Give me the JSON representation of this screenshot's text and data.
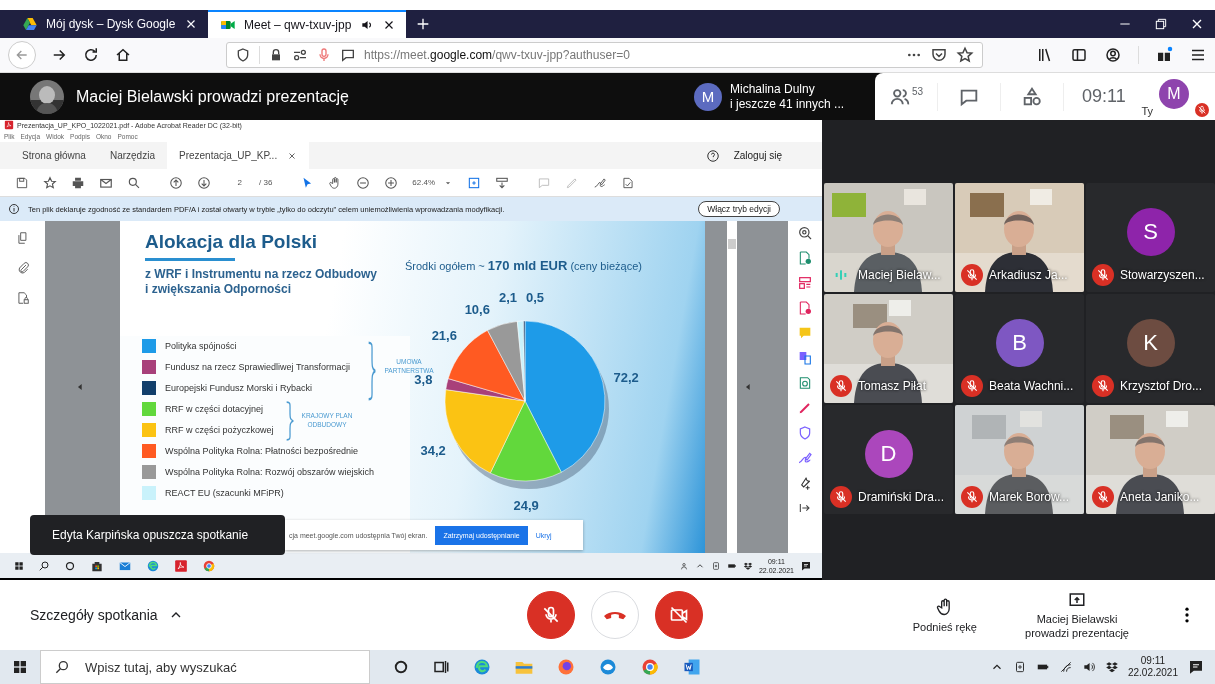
{
  "browser": {
    "tabs": [
      {
        "title": "Mój dysk – Dysk Google",
        "selected": false,
        "audio": false
      },
      {
        "title": "Meet – qwv-txuv-jpp",
        "selected": true,
        "audio": true
      }
    ],
    "url": "https://meet.**google.com**/qwv-txuv-jpp?authuser=0"
  },
  "meet_header": {
    "presenter": "Maciej Bielawski prowadzi prezentację",
    "speaker": {
      "initial": "M",
      "name": "Michalina Dulny",
      "others": "i jeszcze 41 innych ..."
    },
    "participants_count": "53",
    "time": "09:11",
    "self_label": "Ty",
    "self_initial": "M",
    "self_muted": true
  },
  "shared_screen": {
    "acrobat": {
      "title": "Prezentacja_UP_KPO_1022021.pdf - Adobe Acrobat Reader DC (32-bit)",
      "menu": [
        "Plik",
        "Edycja",
        "Widok",
        "Podpis",
        "Okno",
        "Pomoc"
      ],
      "tabs": [
        {
          "label": "Strona główna",
          "selected": false
        },
        {
          "label": "Narzędzia",
          "selected": false
        },
        {
          "label": "Prezentacja_UP_KP...",
          "selected": true
        }
      ],
      "sign_in": "Zaloguj się",
      "page": "2",
      "page_total": "/ 36",
      "zoom": "62.4%",
      "notice": "Ten plik deklaruje zgodność ze standardem PDF/A i został otwarty w trybie „tylko do odczytu” celem uniemożliwienia wprowadzania modyfikacji.",
      "edit_button": "Włącz tryb edycji"
    },
    "slide": {
      "title": "Alokacja dla Polski",
      "subtitle": "z WRF i Instrumentu na rzecz Odbudowy i zwiększania Odporności",
      "total": "Środki ogółem ~ **170 mld EUR** (ceny bieżące)",
      "legend": [
        {
          "label": "Polityka spójności",
          "color": "#1e9be8"
        },
        {
          "label": "Fundusz na rzecz Sprawiedliwej Transformacji",
          "color": "#a8407a"
        },
        {
          "label": "Europejski Fundusz Morski i Rybacki",
          "color": "#123f6b"
        },
        {
          "label": "RRF w części dotacyjnej",
          "color": "#62d83c"
        },
        {
          "label": "RRF w części pożyczkowej",
          "color": "#fbc313"
        },
        {
          "label": "Wspólna Polityka Rolna: Płatności bezpośrednie",
          "color": "#ff5a22"
        },
        {
          "label": "Wspólna Polityka Rolna: Rozwój obszarów wiejskich",
          "color": "#999999"
        },
        {
          "label": "REACT EU (szacunki MFiPR)",
          "color": "#c9f2fb"
        }
      ],
      "groups": [
        {
          "label": "UMOWA PARTNERSTWA"
        },
        {
          "label": "KRAJOWY PLAN ODBUDOWY"
        }
      ],
      "chart_data": {
        "type": "pie",
        "values": [
          72.2,
          24.9,
          34.2,
          3.8,
          21.6,
          10.6,
          2.1,
          0.5
        ],
        "value_labels": [
          "72,2",
          "24,9",
          "34,2",
          "3,8",
          "21,6",
          "10,6",
          "2,1",
          "0,5"
        ],
        "colors": [
          "#1e9be8",
          "#62d83c",
          "#fbc313",
          "#a8407a",
          "#ff5a22",
          "#999999",
          "#c9f2fb",
          "#123f6b"
        ],
        "data_labels": true
      }
    },
    "share_bar": {
      "text": "cja meet.google.com udostępnia Twój ekran.",
      "stop": "Zatrzymaj udostępnianie",
      "hide": "Ukryj"
    },
    "taskbar": {
      "time": "09:11",
      "date": "22.02.2021"
    }
  },
  "notification": "Edyta Karpińska opuszcza spotkanie",
  "tiles": [
    {
      "name": "Maciej Bielaw...",
      "kind": "video",
      "muted": false,
      "speaking": true
    },
    {
      "name": "Arkadiusz Ja...",
      "kind": "video",
      "muted": true,
      "speaking": false
    },
    {
      "name": "Stowarzyszen...",
      "kind": "avatar",
      "initial": "S",
      "color": "#8e24aa",
      "muted": true,
      "speaking": false
    },
    {
      "name": "Tomasz Piłat",
      "kind": "video",
      "muted": true,
      "speaking": false
    },
    {
      "name": "Beata Wachni...",
      "kind": "avatar",
      "initial": "B",
      "color": "#7e57c2",
      "muted": true,
      "speaking": false
    },
    {
      "name": "Krzysztof Dro...",
      "kind": "avatar",
      "initial": "K",
      "color": "#6d4c41",
      "muted": true,
      "speaking": false
    },
    {
      "name": "Dramiński Dra...",
      "kind": "avatar",
      "initial": "D",
      "color": "#ab47bc",
      "muted": true,
      "speaking": false
    },
    {
      "name": "Marek Borow...",
      "kind": "video",
      "muted": true,
      "speaking": false
    },
    {
      "name": "Aneta Janiko...",
      "kind": "video",
      "muted": true,
      "speaking": false
    }
  ],
  "controls": {
    "details": "Szczegóły spotkania",
    "mic_on": false,
    "camera_on": false,
    "raise_hand": "Podnieś rękę",
    "presenting": "Maciej Bielawski prowadzi prezentację"
  },
  "taskbar": {
    "search_placeholder": "Wpisz tutaj, aby wyszukać",
    "time": "09:11",
    "date": "22.02.2021"
  }
}
